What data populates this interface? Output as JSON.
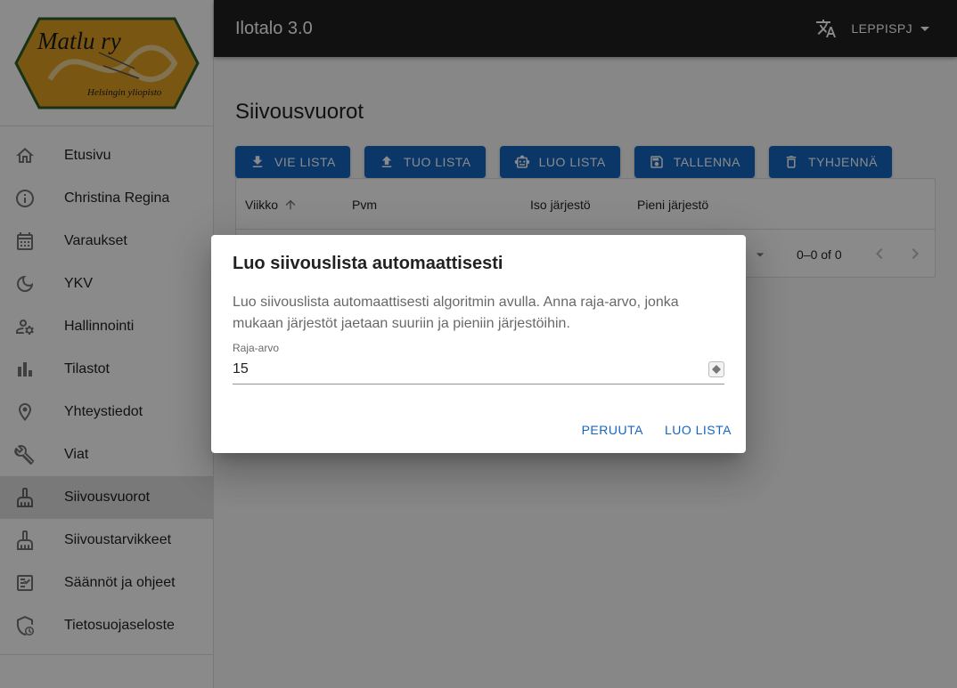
{
  "appbar": {
    "title": "Ilotalo 3.0",
    "user": "LEPPISPJ",
    "language_icon": "translate-icon",
    "dropdown_icon": "arrow-drop-down-icon"
  },
  "logo": {
    "name": "Matlu ry",
    "subtitle": "Helsingin yliopisto"
  },
  "sidebar": {
    "items": [
      {
        "label": "Etusivu",
        "icon": "home-icon"
      },
      {
        "label": "Christina Regina",
        "icon": "info-icon"
      },
      {
        "label": "Varaukset",
        "icon": "calendar-icon"
      },
      {
        "label": "YKV",
        "icon": "moon-icon"
      },
      {
        "label": "Hallinnointi",
        "icon": "manage-accounts-icon"
      },
      {
        "label": "Tilastot",
        "icon": "bar-chart-icon"
      },
      {
        "label": "Yhteystiedot",
        "icon": "location-icon"
      },
      {
        "label": "Viat",
        "icon": "wrench-icon"
      },
      {
        "label": "Siivousvuorot",
        "icon": "cleaning-icon"
      },
      {
        "label": "Siivoustarvikkeet",
        "icon": "cleaning-icon"
      },
      {
        "label": "Säännöt ja ohjeet",
        "icon": "checklist-icon"
      },
      {
        "label": "Tietosuojaseloste",
        "icon": "privacy-icon"
      }
    ],
    "active_index": 8
  },
  "main": {
    "title": "Siivousvuorot",
    "toolbar": {
      "export": "VIE LISTA",
      "import": "TUO LISTA",
      "create": "LUO LISTA",
      "save": "TALLENNA",
      "clear": "TYHJENNÄ"
    },
    "table": {
      "columns": [
        "Viikko",
        "Pvm",
        "Iso järjestö",
        "Pieni järjestö"
      ],
      "pagination": "0–0 of 0"
    }
  },
  "dialog": {
    "title": "Luo siivouslista automaattisesti",
    "text": "Luo siivouslista automaattisesti algoritmin avulla. Anna raja-arvo, jonka mukaan järjestöt jaetaan suuriin ja pieniin järjestöihin.",
    "field_label": "Raja-arvo",
    "field_value": "15",
    "cancel": "PERUUTA",
    "confirm": "LUO LISTA"
  },
  "colors": {
    "appbar": "#212121",
    "primary": "#1565c0",
    "logo_gold": "#e0a224",
    "logo_green": "#2e5d2a"
  }
}
